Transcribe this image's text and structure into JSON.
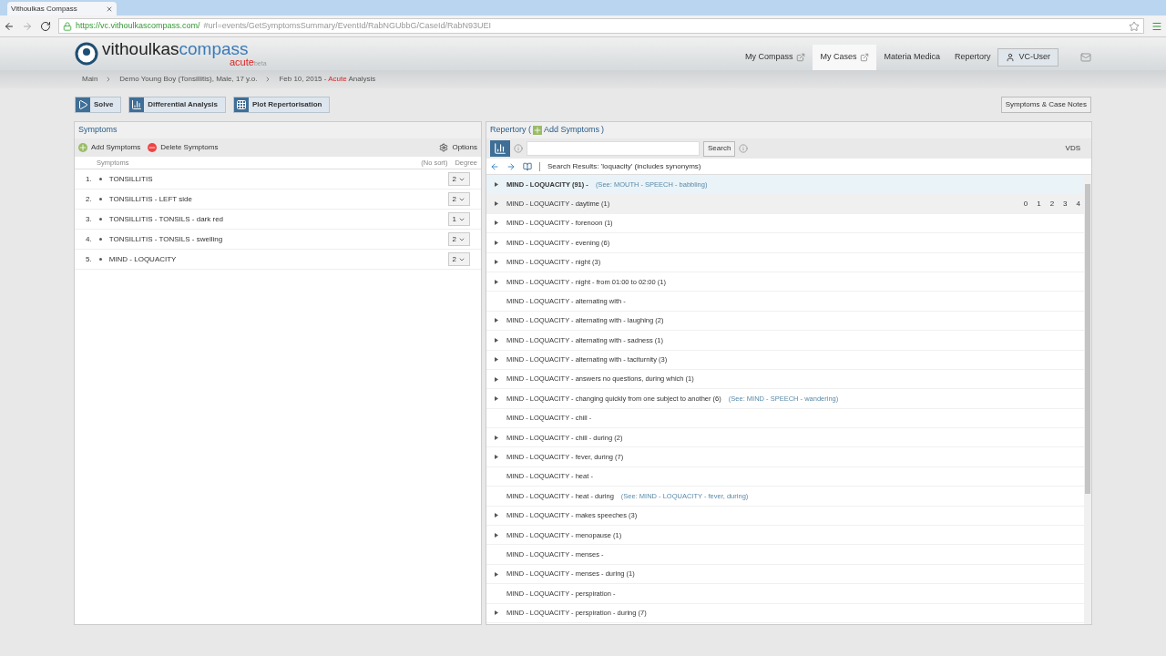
{
  "browser": {
    "tab_title": "Vithoulkas Compass",
    "url_host": "https://vc.vithoulkascompass.com/",
    "url_path": "#url=events/GetSymptomsSummary/EventId/RabNGUbbG/CaseId/RabN93UEI"
  },
  "logo": {
    "part_1": "vithoulkas",
    "part_2": "compass",
    "part_3": "acute",
    "part_4": "beta"
  },
  "nav": [
    {
      "label": "My Compass",
      "selected": false,
      "external": true
    },
    {
      "label": "My Cases",
      "selected": true,
      "external": true
    },
    {
      "label": "Materia Medica",
      "selected": false,
      "external": false
    },
    {
      "label": "Repertory",
      "selected": false,
      "external": false
    }
  ],
  "user": "VC-User",
  "breadcrumb": {
    "items": [
      "Main",
      "Demo Young Boy (Tonsillitis), Male, 17 y.o."
    ],
    "last_date": "Feb 10, 2015 - ",
    "last_red": "Acute",
    "last_rest": " Analysis"
  },
  "toolbar": [
    "Solve",
    "Differential Analysis",
    "Plot Repertorisation"
  ],
  "notes_button": "Symptoms & Case Notes",
  "symptoms": {
    "title": "Symptoms",
    "add": "Add Symptoms",
    "delete": "Delete Symptoms",
    "options": "Options",
    "col_symptom": "Symptoms",
    "col_sort": "(No sort)",
    "col_degree": "Degree",
    "rows": [
      {
        "num": "1.",
        "text": "TONSILLITIS",
        "degree": "2"
      },
      {
        "num": "2.",
        "text": "TONSILLITIS - LEFT side",
        "degree": "2"
      },
      {
        "num": "3.",
        "text": "TONSILLITIS - TONSILS - dark red",
        "degree": "1"
      },
      {
        "num": "4.",
        "text": "TONSILLITIS - TONSILS - swelling",
        "degree": "2"
      },
      {
        "num": "5.",
        "text": "MIND - LOQUACITY",
        "degree": "2"
      }
    ]
  },
  "repertory": {
    "title": "Repertory (",
    "add": "Add Symptoms",
    "close": ")",
    "search_button": "Search",
    "book": "VDS",
    "results": "Search Results: 'loquacity' (includes synonyms)",
    "rows": [
      {
        "text": "MIND - LOQUACITY (91) -",
        "see": "(See: MOUTH - SPEECH - babbling)",
        "expandable": true,
        "selected": true,
        "grades": []
      },
      {
        "text": "MIND - LOQUACITY - daytime (1)",
        "see": "",
        "expandable": true,
        "selected": false,
        "grades": [
          "0",
          "1",
          "2",
          "3",
          "4"
        ]
      },
      {
        "text": "MIND - LOQUACITY - forenoon (1)",
        "expandable": true,
        "selected": false,
        "grades": []
      },
      {
        "text": "MIND - LOQUACITY - evening (6)",
        "expandable": true,
        "selected": false,
        "grades": []
      },
      {
        "text": "MIND - LOQUACITY - night (3)",
        "expandable": true,
        "selected": false,
        "grades": []
      },
      {
        "text": "MIND - LOQUACITY - night - from 01:00 to 02:00 (1)",
        "expandable": true,
        "selected": false,
        "grades": []
      },
      {
        "text": "MIND - LOQUACITY - alternating with -",
        "expandable": false,
        "selected": false,
        "grades": []
      },
      {
        "text": "MIND - LOQUACITY - alternating with - laughing (2)",
        "expandable": true,
        "selected": false,
        "grades": []
      },
      {
        "text": "MIND - LOQUACITY - alternating with - sadness (1)",
        "expandable": true,
        "selected": false,
        "grades": []
      },
      {
        "text": "MIND - LOQUACITY - alternating with - taciturnity (3)",
        "expandable": true,
        "selected": false,
        "grades": []
      },
      {
        "text": "MIND - LOQUACITY - answers no questions, during which (1)",
        "expandable": true,
        "selected": false,
        "grades": []
      },
      {
        "text": "MIND - LOQUACITY - changing quickly from one subject to another (6)",
        "see": "(See: MIND - SPEECH - wandering)",
        "expandable": true,
        "selected": false,
        "grades": []
      },
      {
        "text": "MIND - LOQUACITY - chill -",
        "expandable": false,
        "selected": false,
        "grades": []
      },
      {
        "text": "MIND - LOQUACITY - chill - during (2)",
        "expandable": true,
        "selected": false,
        "grades": []
      },
      {
        "text": "MIND - LOQUACITY - fever, during (7)",
        "expandable": true,
        "selected": false,
        "grades": []
      },
      {
        "text": "MIND - LOQUACITY - heat -",
        "expandable": false,
        "selected": false,
        "grades": []
      },
      {
        "text": "MIND - LOQUACITY - heat - during",
        "see": "(See: MIND - LOQUACITY - fever, during)",
        "expandable": false,
        "selected": false,
        "grades": []
      },
      {
        "text": "MIND - LOQUACITY - makes speeches (3)",
        "expandable": true,
        "selected": false,
        "grades": []
      },
      {
        "text": "MIND - LOQUACITY - menopause (1)",
        "expandable": true,
        "selected": false,
        "grades": []
      },
      {
        "text": "MIND - LOQUACITY - menses -",
        "expandable": false,
        "selected": false,
        "grades": []
      },
      {
        "text": "MIND - LOQUACITY - menses - during (1)",
        "expandable": true,
        "selected": false,
        "grades": []
      },
      {
        "text": "MIND - LOQUACITY - perspiration -",
        "expandable": false,
        "selected": false,
        "grades": []
      },
      {
        "text": "MIND - LOQUACITY - perspiration - during (7)",
        "expandable": true,
        "selected": false,
        "grades": []
      }
    ]
  }
}
